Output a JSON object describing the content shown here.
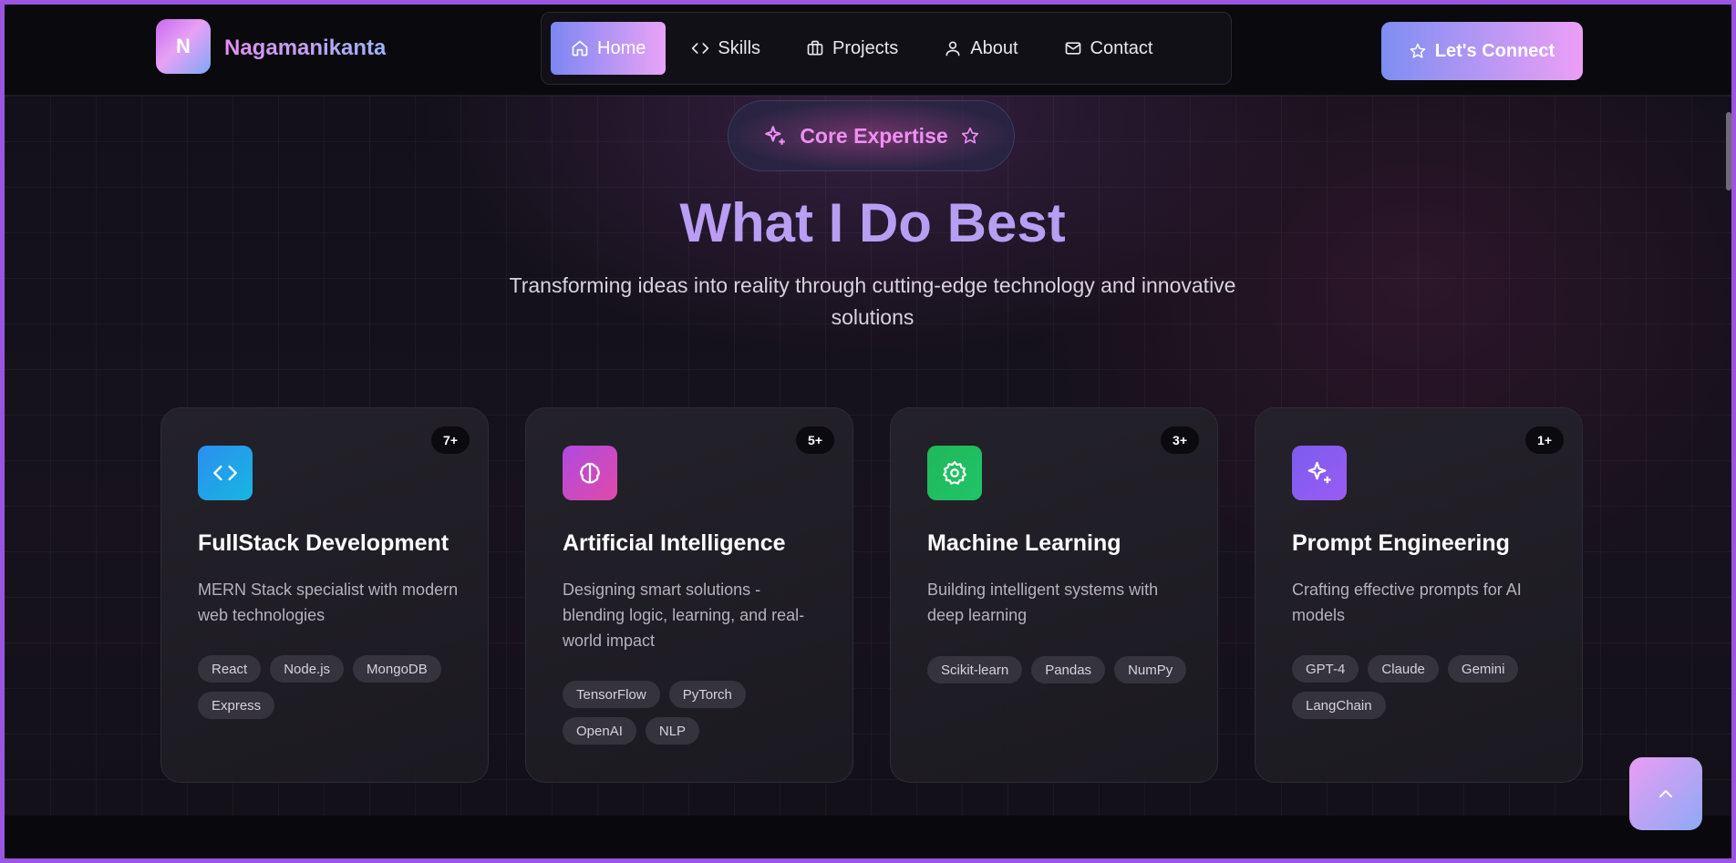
{
  "brand": {
    "initial": "N",
    "name": "Nagamanikanta"
  },
  "nav": {
    "items": [
      {
        "label": "Home",
        "icon": "home-icon",
        "active": true
      },
      {
        "label": "Skills",
        "icon": "code-icon",
        "active": false
      },
      {
        "label": "Projects",
        "icon": "briefcase-icon",
        "active": false
      },
      {
        "label": "About",
        "icon": "user-icon",
        "active": false
      },
      {
        "label": "Contact",
        "icon": "mail-icon",
        "active": false
      }
    ],
    "cta_label": "Let's Connect"
  },
  "hero": {
    "pill_label": "Core Expertise",
    "title": "What I Do Best",
    "subtitle": "Transforming ideas into reality through cutting-edge technology and innovative solutions"
  },
  "cards": [
    {
      "count": "7+",
      "icon": "code-icon",
      "icon_color": "#1ea6e8",
      "title": "FullStack Development",
      "description": "MERN Stack specialist with modern web technologies",
      "tags": [
        "React",
        "Node.js",
        "MongoDB",
        "Express"
      ]
    },
    {
      "count": "5+",
      "icon": "brain-icon",
      "icon_color": "#d250c8",
      "title": "Artificial Intelligence",
      "description": "Designing smart solutions - blending logic, learning, and real-world impact",
      "tags": [
        "TensorFlow",
        "PyTorch",
        "OpenAI",
        "NLP"
      ]
    },
    {
      "count": "3+",
      "icon": "gear-icon",
      "icon_color": "#22c25a",
      "title": "Machine Learning",
      "description": "Building intelligent systems with deep learning",
      "tags": [
        "Scikit-learn",
        "Pandas",
        "NumPy"
      ]
    },
    {
      "count": "1+",
      "icon": "sparkles-icon",
      "icon_color": "#8a5cf2",
      "title": "Prompt Engineering",
      "description": "Crafting effective prompts for AI models",
      "tags": [
        "GPT-4",
        "Claude",
        "Gemini",
        "LangChain"
      ]
    }
  ],
  "colors": {
    "frame": "#9b55e0",
    "accent_start": "#7e8ef2",
    "accent_end": "#ec9ff5"
  }
}
